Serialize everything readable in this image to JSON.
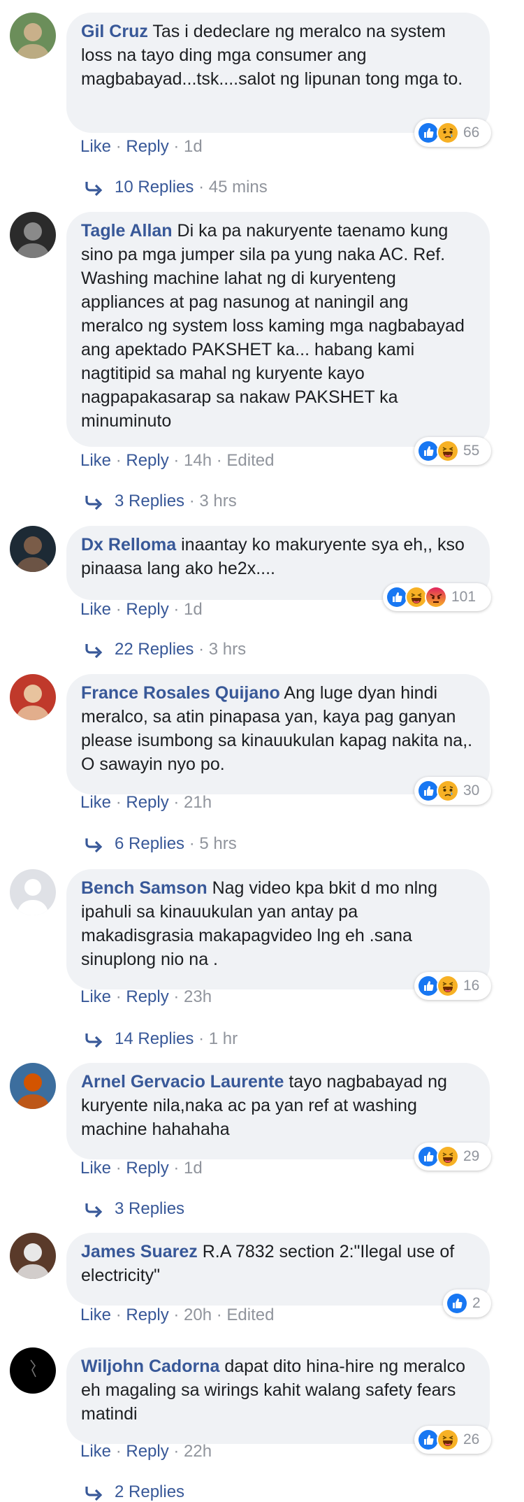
{
  "comments": [
    {
      "author": "Gil Cruz",
      "text": "Tas i dedeclare ng meralco na system loss na tayo ding mga consumer ang magbabayad...tsk....salot ng lipunan tong mga to.",
      "like_label": "Like",
      "reply_label": "Reply",
      "time": "1d",
      "edited": "",
      "reaction_count": "66",
      "reactions": [
        "like-icon",
        "sad-icon"
      ],
      "replies_label": "10 Replies",
      "replies_time": "45 mins",
      "avatar_colors": [
        "#6b8e5a",
        "#c9b08a"
      ]
    },
    {
      "author": "Tagle Allan",
      "text": "Di ka pa nakuryente taenamo kung sino pa mga jumper sila pa yung naka AC. Ref. Washing machine lahat ng di kuryenteng appliances at pag nasunog at naningil ang meralco ng system loss kaming mga nagbabayad ang apektado PAKSHET ka... habang kami nagtitipid sa mahal ng kuryente kayo nagpapakasarap sa nakaw PAKSHET ka minuminuto",
      "like_label": "Like",
      "reply_label": "Reply",
      "time": "14h",
      "edited": "Edited",
      "reaction_count": "55",
      "reactions": [
        "like-icon",
        "haha-icon"
      ],
      "replies_label": "3 Replies",
      "replies_time": "3 hrs",
      "avatar_colors": [
        "#2b2b2b",
        "#8a8a8a"
      ]
    },
    {
      "author": "Dx Relloma",
      "text": "inaantay ko makuryente sya eh,, kso pinaasa lang ako he2x....",
      "like_label": "Like",
      "reply_label": "Reply",
      "time": "1d",
      "edited": "",
      "reaction_count": "101",
      "reactions": [
        "like-icon",
        "haha-icon",
        "angry-icon"
      ],
      "replies_label": "22 Replies",
      "replies_time": "3 hrs",
      "avatar_colors": [
        "#1d2a35",
        "#7a5c48"
      ]
    },
    {
      "author": "France Rosales Quijano",
      "text": "Ang luge dyan hindi meralco, sa atin pinapasa yan, kaya pag ganyan please isumbong sa kinauukulan kapag nakita na,. O sawayin nyo po.",
      "like_label": "Like",
      "reply_label": "Reply",
      "time": "21h",
      "edited": "",
      "reaction_count": "30",
      "reactions": [
        "like-icon",
        "sad-icon"
      ],
      "replies_label": "6 Replies",
      "replies_time": "5 hrs",
      "avatar_colors": [
        "#c0392b",
        "#e8c39e"
      ]
    },
    {
      "author": "Bench Samson",
      "text": "Nag video kpa bkit d mo nlng ipahuli sa kinauukulan yan antay pa makadisgrasia makapagvideo lng eh .sana sinuplong nio na .",
      "like_label": "Like",
      "reply_label": "Reply",
      "time": "23h",
      "edited": "",
      "reaction_count": "16",
      "reactions": [
        "like-icon",
        "haha-icon"
      ],
      "replies_label": "14 Replies",
      "replies_time": "1 hr",
      "avatar_colors": [
        "#dfe1e6",
        "#ffffff"
      ]
    },
    {
      "author": "Arnel Gervacio Laurente",
      "text": "tayo nagbabayad ng kuryente nila,naka ac pa yan ref at washing machine hahahaha",
      "like_label": "Like",
      "reply_label": "Reply",
      "time": "1d",
      "edited": "",
      "reaction_count": "29",
      "reactions": [
        "like-icon",
        "haha-icon"
      ],
      "replies_label": "3 Replies",
      "replies_time": "",
      "avatar_colors": [
        "#3c6e9e",
        "#d35400"
      ]
    },
    {
      "author": "James Suarez",
      "text": "R.A 7832 section 2:\"Ilegal use of electricity\"",
      "like_label": "Like",
      "reply_label": "Reply",
      "time": "20h",
      "edited": "Edited",
      "reaction_count": "2",
      "reactions": [
        "like-icon"
      ],
      "replies_label": "",
      "replies_time": "",
      "avatar_colors": [
        "#5a3a2a",
        "#e8e8e8"
      ]
    },
    {
      "author": "Wiljohn Cadorna",
      "text": "dapat dito hina-hire ng meralco eh magaling sa wirings kahit walang safety fears matindi",
      "like_label": "Like",
      "reply_label": "Reply",
      "time": "22h",
      "edited": "",
      "reaction_count": "26",
      "reactions": [
        "like-icon",
        "haha-icon"
      ],
      "replies_label": "2 Replies",
      "replies_time": "",
      "avatar_colors": [
        "#000000",
        "#444444"
      ]
    }
  ],
  "colors": {
    "link": "#385898",
    "meta": "#90949c",
    "bubble": "#f0f2f5",
    "like": "#1877f2",
    "haha": "#f7b125",
    "angry": "#e9710f"
  }
}
